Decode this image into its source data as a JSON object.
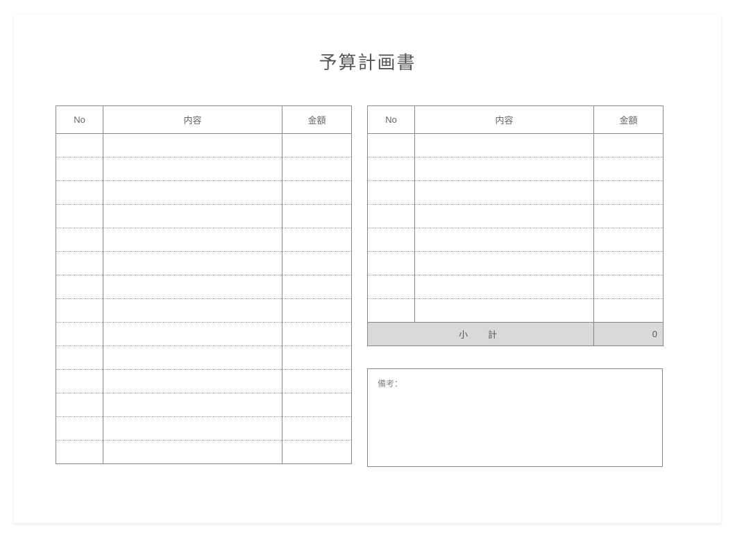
{
  "title": "予算計画書",
  "headers": {
    "no": "No",
    "description": "内容",
    "amount": "金額"
  },
  "left_table": {
    "rows": [
      {
        "no": "",
        "desc": "",
        "amount": ""
      },
      {
        "no": "",
        "desc": "",
        "amount": ""
      },
      {
        "no": "",
        "desc": "",
        "amount": ""
      },
      {
        "no": "",
        "desc": "",
        "amount": ""
      },
      {
        "no": "",
        "desc": "",
        "amount": ""
      },
      {
        "no": "",
        "desc": "",
        "amount": ""
      },
      {
        "no": "",
        "desc": "",
        "amount": ""
      },
      {
        "no": "",
        "desc": "",
        "amount": ""
      },
      {
        "no": "",
        "desc": "",
        "amount": ""
      },
      {
        "no": "",
        "desc": "",
        "amount": ""
      },
      {
        "no": "",
        "desc": "",
        "amount": ""
      },
      {
        "no": "",
        "desc": "",
        "amount": ""
      },
      {
        "no": "",
        "desc": "",
        "amount": ""
      },
      {
        "no": "",
        "desc": "",
        "amount": ""
      }
    ]
  },
  "right_table": {
    "rows": [
      {
        "no": "",
        "desc": "",
        "amount": ""
      },
      {
        "no": "",
        "desc": "",
        "amount": ""
      },
      {
        "no": "",
        "desc": "",
        "amount": ""
      },
      {
        "no": "",
        "desc": "",
        "amount": ""
      },
      {
        "no": "",
        "desc": "",
        "amount": ""
      },
      {
        "no": "",
        "desc": "",
        "amount": ""
      },
      {
        "no": "",
        "desc": "",
        "amount": ""
      },
      {
        "no": "",
        "desc": "",
        "amount": ""
      }
    ],
    "subtotal_label": "小　計",
    "subtotal_value": "0"
  },
  "remarks_label": "備考："
}
